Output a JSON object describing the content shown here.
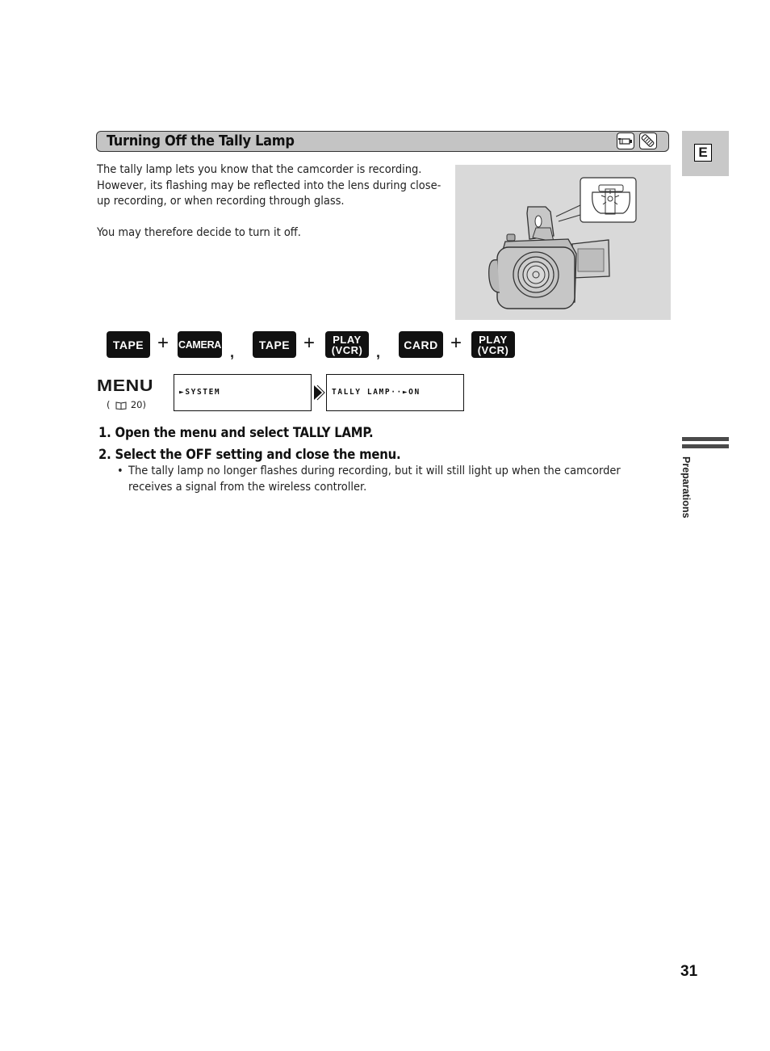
{
  "section": {
    "title": "Turning Off the Tally Lamp",
    "mode_icons": [
      "camcorder-icon",
      "card-icon"
    ]
  },
  "language_tab": {
    "letter": "E"
  },
  "intro": {
    "paragraph1": "The tally lamp lets you know that the camcorder is recording. However, its flashing may be reflected into the lens during close-up recording, or when recording through glass.",
    "paragraph2": "You may therefore decide to turn it off."
  },
  "illustration": {
    "subject": "camcorder-tally-lamp-callout"
  },
  "mode_combos": {
    "combo1": {
      "key1": "TAPE",
      "plus": "+",
      "key2": "CAMERA",
      "sep": ","
    },
    "combo2": {
      "key1": "TAPE",
      "plus": "+",
      "key2_line1": "PLAY",
      "key2_line2": "(VCR)",
      "sep": ","
    },
    "combo3": {
      "key1": "CARD",
      "plus": "+",
      "key2_line1": "PLAY",
      "key2_line2": "(VCR)"
    }
  },
  "menu": {
    "label": "MENU",
    "ref_open": "(",
    "ref_page": "20)",
    "screen1": "►SYSTEM",
    "screen2": "TALLY LAMP··►ON"
  },
  "steps": [
    {
      "text": "1.  Open the menu and select TALLY LAMP."
    },
    {
      "text": "2.  Select the OFF setting and close the menu."
    }
  ],
  "notes": [
    {
      "bullet": "•",
      "text": "The tally lamp no longer flashes during recording, but it will still light up when the camcorder receives a signal from the wireless controller."
    }
  ],
  "side": {
    "chapter": "Preparations"
  },
  "page_number": "31"
}
